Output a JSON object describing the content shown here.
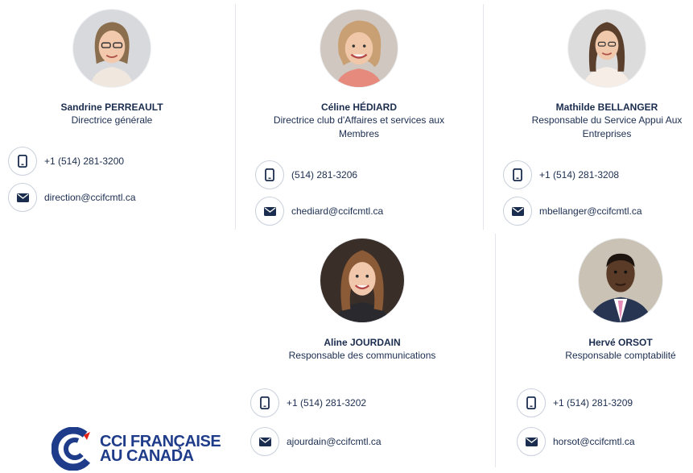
{
  "team": [
    {
      "name": "Sandrine PERREAULT",
      "role": "Directrice générale",
      "phone": "+1 (514) 281-3200",
      "email": "direction@ccifcmtl.ca"
    },
    {
      "name": "Céline HÉDIARD",
      "role": "Directrice club d'Affaires et services aux Membres",
      "phone": "(514) 281-3206",
      "email": "chediard@ccifcmtl.ca"
    },
    {
      "name": "Mathilde BELLANGER",
      "role": "Responsable du Service Appui Aux Entreprises",
      "phone": "+1 (514) 281-3208",
      "email": "mbellanger@ccifcmtl.ca"
    },
    {
      "name": "Aline JOURDAIN",
      "role": "Responsable des communications",
      "phone": "+1 (514) 281-3202",
      "email": "ajourdain@ccifcmtl.ca"
    },
    {
      "name": "Hervé ORSOT",
      "role": "Responsable comptabilité",
      "phone": "+1 (514) 281-3209",
      "email": "horsot@ccifcmtl.ca"
    }
  ],
  "logo": {
    "line1": "CCI FRANÇAISE",
    "line2": "AU CANADA"
  },
  "colors": {
    "text": "#1b2d4f",
    "logo_blue": "#1f3c8a",
    "logo_red": "#e2231a",
    "icon": "#1b2d4f",
    "divider": "#e3e6ea"
  }
}
